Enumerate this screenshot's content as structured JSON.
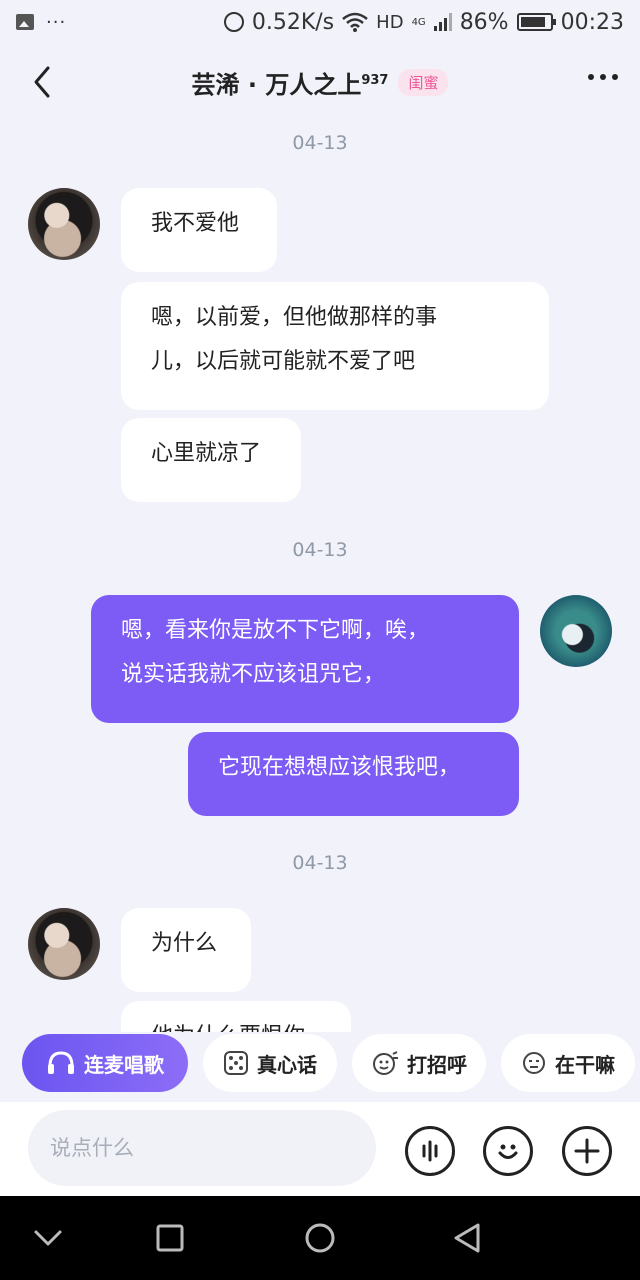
{
  "status_bar": {
    "net_speed": "0.52K/s",
    "network_type": "HD",
    "signal_type": "4G",
    "battery": "86%",
    "battery_level": 0.86,
    "time": "00:23"
  },
  "header": {
    "title": "芸浠 · 万人之上",
    "title_superscript": "937",
    "badge": "闺蜜"
  },
  "messages": {
    "date_1": "04-13",
    "in_1": "我不爱他",
    "in_2_line1": "嗯，以前爱，但他做那样的事",
    "in_2_line2": "儿，以后就可能就不爱了吧",
    "in_3": "心里就凉了",
    "date_2": "04-13",
    "out_1_line1": "嗯，看来你是放不下它啊，唉，",
    "out_1_line2": "说实话我就不应该诅咒它，",
    "out_2": "它现在想想应该恨我吧，",
    "date_3": "04-13",
    "in_4": "为什么",
    "in_5_partial": "他为什么要恨你"
  },
  "quick_actions": [
    {
      "label": "连麦唱歌",
      "icon": "headphones-icon"
    },
    {
      "label": "真心话",
      "icon": "dice-icon"
    },
    {
      "label": "打招呼",
      "icon": "greeting-icon"
    },
    {
      "label": "在干嘛",
      "icon": "face-icon"
    }
  ],
  "input": {
    "placeholder": "说点什么"
  },
  "colors": {
    "accent": "#7C5CF5",
    "background": "#F1F2FA",
    "badge_text": "#F05595"
  }
}
